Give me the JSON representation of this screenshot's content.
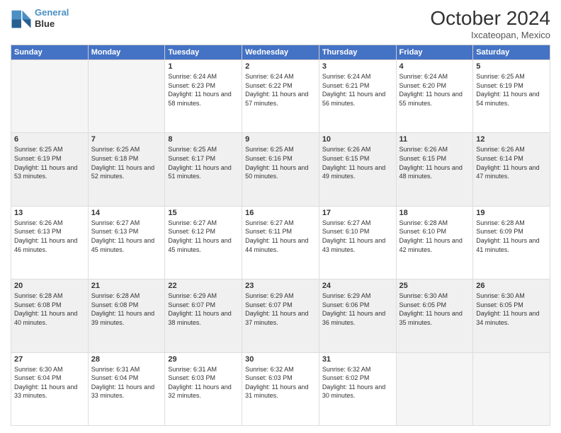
{
  "header": {
    "logo_line1": "General",
    "logo_line2": "Blue",
    "month": "October 2024",
    "location": "Ixcateopan, Mexico"
  },
  "weekdays": [
    "Sunday",
    "Monday",
    "Tuesday",
    "Wednesday",
    "Thursday",
    "Friday",
    "Saturday"
  ],
  "weeks": [
    [
      {
        "day": "",
        "sunrise": "",
        "sunset": "",
        "daylight": ""
      },
      {
        "day": "",
        "sunrise": "",
        "sunset": "",
        "daylight": ""
      },
      {
        "day": "1",
        "sunrise": "Sunrise: 6:24 AM",
        "sunset": "Sunset: 6:23 PM",
        "daylight": "Daylight: 11 hours and 58 minutes."
      },
      {
        "day": "2",
        "sunrise": "Sunrise: 6:24 AM",
        "sunset": "Sunset: 6:22 PM",
        "daylight": "Daylight: 11 hours and 57 minutes."
      },
      {
        "day": "3",
        "sunrise": "Sunrise: 6:24 AM",
        "sunset": "Sunset: 6:21 PM",
        "daylight": "Daylight: 11 hours and 56 minutes."
      },
      {
        "day": "4",
        "sunrise": "Sunrise: 6:24 AM",
        "sunset": "Sunset: 6:20 PM",
        "daylight": "Daylight: 11 hours and 55 minutes."
      },
      {
        "day": "5",
        "sunrise": "Sunrise: 6:25 AM",
        "sunset": "Sunset: 6:19 PM",
        "daylight": "Daylight: 11 hours and 54 minutes."
      }
    ],
    [
      {
        "day": "6",
        "sunrise": "Sunrise: 6:25 AM",
        "sunset": "Sunset: 6:19 PM",
        "daylight": "Daylight: 11 hours and 53 minutes."
      },
      {
        "day": "7",
        "sunrise": "Sunrise: 6:25 AM",
        "sunset": "Sunset: 6:18 PM",
        "daylight": "Daylight: 11 hours and 52 minutes."
      },
      {
        "day": "8",
        "sunrise": "Sunrise: 6:25 AM",
        "sunset": "Sunset: 6:17 PM",
        "daylight": "Daylight: 11 hours and 51 minutes."
      },
      {
        "day": "9",
        "sunrise": "Sunrise: 6:25 AM",
        "sunset": "Sunset: 6:16 PM",
        "daylight": "Daylight: 11 hours and 50 minutes."
      },
      {
        "day": "10",
        "sunrise": "Sunrise: 6:26 AM",
        "sunset": "Sunset: 6:15 PM",
        "daylight": "Daylight: 11 hours and 49 minutes."
      },
      {
        "day": "11",
        "sunrise": "Sunrise: 6:26 AM",
        "sunset": "Sunset: 6:15 PM",
        "daylight": "Daylight: 11 hours and 48 minutes."
      },
      {
        "day": "12",
        "sunrise": "Sunrise: 6:26 AM",
        "sunset": "Sunset: 6:14 PM",
        "daylight": "Daylight: 11 hours and 47 minutes."
      }
    ],
    [
      {
        "day": "13",
        "sunrise": "Sunrise: 6:26 AM",
        "sunset": "Sunset: 6:13 PM",
        "daylight": "Daylight: 11 hours and 46 minutes."
      },
      {
        "day": "14",
        "sunrise": "Sunrise: 6:27 AM",
        "sunset": "Sunset: 6:13 PM",
        "daylight": "Daylight: 11 hours and 45 minutes."
      },
      {
        "day": "15",
        "sunrise": "Sunrise: 6:27 AM",
        "sunset": "Sunset: 6:12 PM",
        "daylight": "Daylight: 11 hours and 45 minutes."
      },
      {
        "day": "16",
        "sunrise": "Sunrise: 6:27 AM",
        "sunset": "Sunset: 6:11 PM",
        "daylight": "Daylight: 11 hours and 44 minutes."
      },
      {
        "day": "17",
        "sunrise": "Sunrise: 6:27 AM",
        "sunset": "Sunset: 6:10 PM",
        "daylight": "Daylight: 11 hours and 43 minutes."
      },
      {
        "day": "18",
        "sunrise": "Sunrise: 6:28 AM",
        "sunset": "Sunset: 6:10 PM",
        "daylight": "Daylight: 11 hours and 42 minutes."
      },
      {
        "day": "19",
        "sunrise": "Sunrise: 6:28 AM",
        "sunset": "Sunset: 6:09 PM",
        "daylight": "Daylight: 11 hours and 41 minutes."
      }
    ],
    [
      {
        "day": "20",
        "sunrise": "Sunrise: 6:28 AM",
        "sunset": "Sunset: 6:08 PM",
        "daylight": "Daylight: 11 hours and 40 minutes."
      },
      {
        "day": "21",
        "sunrise": "Sunrise: 6:28 AM",
        "sunset": "Sunset: 6:08 PM",
        "daylight": "Daylight: 11 hours and 39 minutes."
      },
      {
        "day": "22",
        "sunrise": "Sunrise: 6:29 AM",
        "sunset": "Sunset: 6:07 PM",
        "daylight": "Daylight: 11 hours and 38 minutes."
      },
      {
        "day": "23",
        "sunrise": "Sunrise: 6:29 AM",
        "sunset": "Sunset: 6:07 PM",
        "daylight": "Daylight: 11 hours and 37 minutes."
      },
      {
        "day": "24",
        "sunrise": "Sunrise: 6:29 AM",
        "sunset": "Sunset: 6:06 PM",
        "daylight": "Daylight: 11 hours and 36 minutes."
      },
      {
        "day": "25",
        "sunrise": "Sunrise: 6:30 AM",
        "sunset": "Sunset: 6:05 PM",
        "daylight": "Daylight: 11 hours and 35 minutes."
      },
      {
        "day": "26",
        "sunrise": "Sunrise: 6:30 AM",
        "sunset": "Sunset: 6:05 PM",
        "daylight": "Daylight: 11 hours and 34 minutes."
      }
    ],
    [
      {
        "day": "27",
        "sunrise": "Sunrise: 6:30 AM",
        "sunset": "Sunset: 6:04 PM",
        "daylight": "Daylight: 11 hours and 33 minutes."
      },
      {
        "day": "28",
        "sunrise": "Sunrise: 6:31 AM",
        "sunset": "Sunset: 6:04 PM",
        "daylight": "Daylight: 11 hours and 33 minutes."
      },
      {
        "day": "29",
        "sunrise": "Sunrise: 6:31 AM",
        "sunset": "Sunset: 6:03 PM",
        "daylight": "Daylight: 11 hours and 32 minutes."
      },
      {
        "day": "30",
        "sunrise": "Sunrise: 6:32 AM",
        "sunset": "Sunset: 6:03 PM",
        "daylight": "Daylight: 11 hours and 31 minutes."
      },
      {
        "day": "31",
        "sunrise": "Sunrise: 6:32 AM",
        "sunset": "Sunset: 6:02 PM",
        "daylight": "Daylight: 11 hours and 30 minutes."
      },
      {
        "day": "",
        "sunrise": "",
        "sunset": "",
        "daylight": ""
      },
      {
        "day": "",
        "sunrise": "",
        "sunset": "",
        "daylight": ""
      }
    ]
  ]
}
